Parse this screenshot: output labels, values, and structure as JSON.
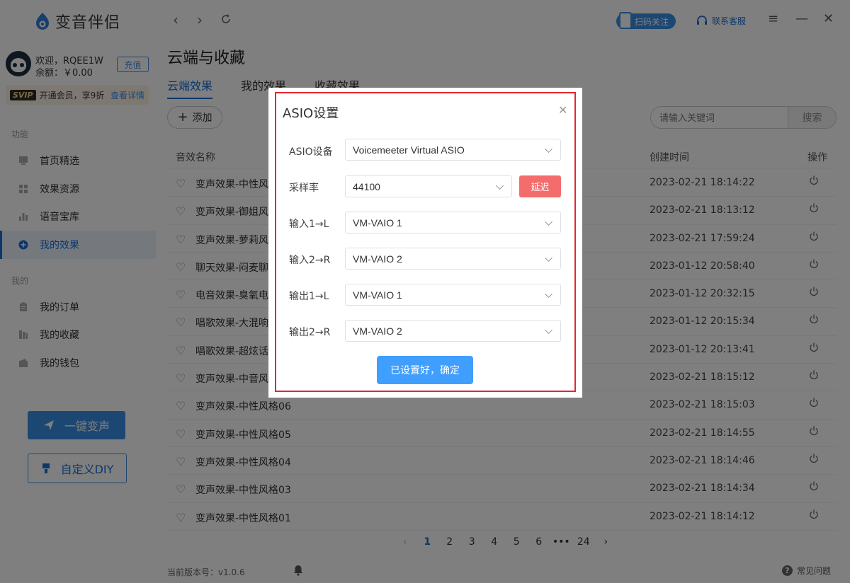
{
  "app": {
    "name": "变音伴侣"
  },
  "user": {
    "welcome": "欢迎，RQEE1W",
    "balance": "余额：￥0.00",
    "recharge_label": "充值"
  },
  "vip": {
    "badge": "SVIP",
    "text": "开通会员，享9折",
    "link": "查看详情"
  },
  "sidebar": {
    "group_function": "功能",
    "group_mine": "我的",
    "items": [
      {
        "label": "首页精选",
        "icon": "monitor-icon"
      },
      {
        "label": "效果资源",
        "icon": "grid-icon"
      },
      {
        "label": "语音宝库",
        "icon": "bars-icon"
      },
      {
        "label": "我的效果",
        "icon": "plus-circle-icon",
        "active": true
      },
      {
        "label": "我的订单",
        "icon": "clipboard-icon"
      },
      {
        "label": "我的收藏",
        "icon": "bookmark-icon"
      },
      {
        "label": "我的钱包",
        "icon": "wallet-icon"
      }
    ],
    "one_key_label": "一键变声",
    "diy_label": "自定义DIY"
  },
  "topbar": {
    "qr_label": "扫码关注",
    "service_label": "联系客服"
  },
  "main": {
    "title": "云端与收藏",
    "tabs": [
      "云端效果",
      "我的效果",
      "收藏效果"
    ],
    "add_label": "添加",
    "search_placeholder": "请输入关键词",
    "search_button": "搜索",
    "columns": {
      "name": "音效名称",
      "time": "创建时间",
      "action": "操作"
    },
    "rows": [
      {
        "name": "变声效果-中性风",
        "time": "2023-02-21 18:14:22"
      },
      {
        "name": "变声效果-御姐风",
        "time": "2023-02-21 18:13:12"
      },
      {
        "name": "变声效果-萝莉风",
        "time": "2023-02-21 17:59:24"
      },
      {
        "name": "聊天效果-闷麦聊",
        "time": "2023-01-12 20:58:40"
      },
      {
        "name": "电音效果-臭氧电",
        "time": "2023-01-12 20:32:15"
      },
      {
        "name": "唱歌效果-大混响",
        "time": "2023-01-12 20:15:34"
      },
      {
        "name": "唱歌效果-超炫话",
        "time": "2023-01-12 20:13:41"
      },
      {
        "name": "变声效果-中音风",
        "time": "2023-02-21 18:15:12"
      },
      {
        "name": "变声效果-中性风格06",
        "time": "2023-02-21 18:15:03"
      },
      {
        "name": "变声效果-中性风格05",
        "time": "2023-02-21 18:14:55"
      },
      {
        "name": "变声效果-中性风格04",
        "time": "2023-02-21 18:14:46"
      },
      {
        "name": "变声效果-中性风格03",
        "time": "2023-02-21 18:14:34"
      },
      {
        "name": "变声效果-中性风格01",
        "time": "2023-02-21 18:14:12"
      }
    ],
    "pagination": [
      "1",
      "2",
      "3",
      "4",
      "5",
      "6",
      "•••",
      "24"
    ],
    "current_page": "1",
    "version": "当前版本号：v1.0.6",
    "help": "常见问题"
  },
  "modal": {
    "title": "ASIO设置",
    "fields": [
      {
        "label": "ASIO设备",
        "value": "Voicemeeter Virtual ASIO"
      },
      {
        "label": "采样率",
        "value": "44100"
      },
      {
        "label": "输入1→L",
        "value": "VM-VAIO 1"
      },
      {
        "label": "输入2→R",
        "value": "VM-VAIO 2"
      },
      {
        "label": "输出1→L",
        "value": "VM-VAIO 1"
      },
      {
        "label": "输出2→R",
        "value": "VM-VAIO 2"
      }
    ],
    "delay_label": "延迟",
    "confirm_label": "已设置好，确定"
  },
  "colors": {
    "primary": "#409eff",
    "accent_dark": "#1b6fd6",
    "danger": "#f56c6c",
    "highlight_frame": "#e0282e"
  }
}
